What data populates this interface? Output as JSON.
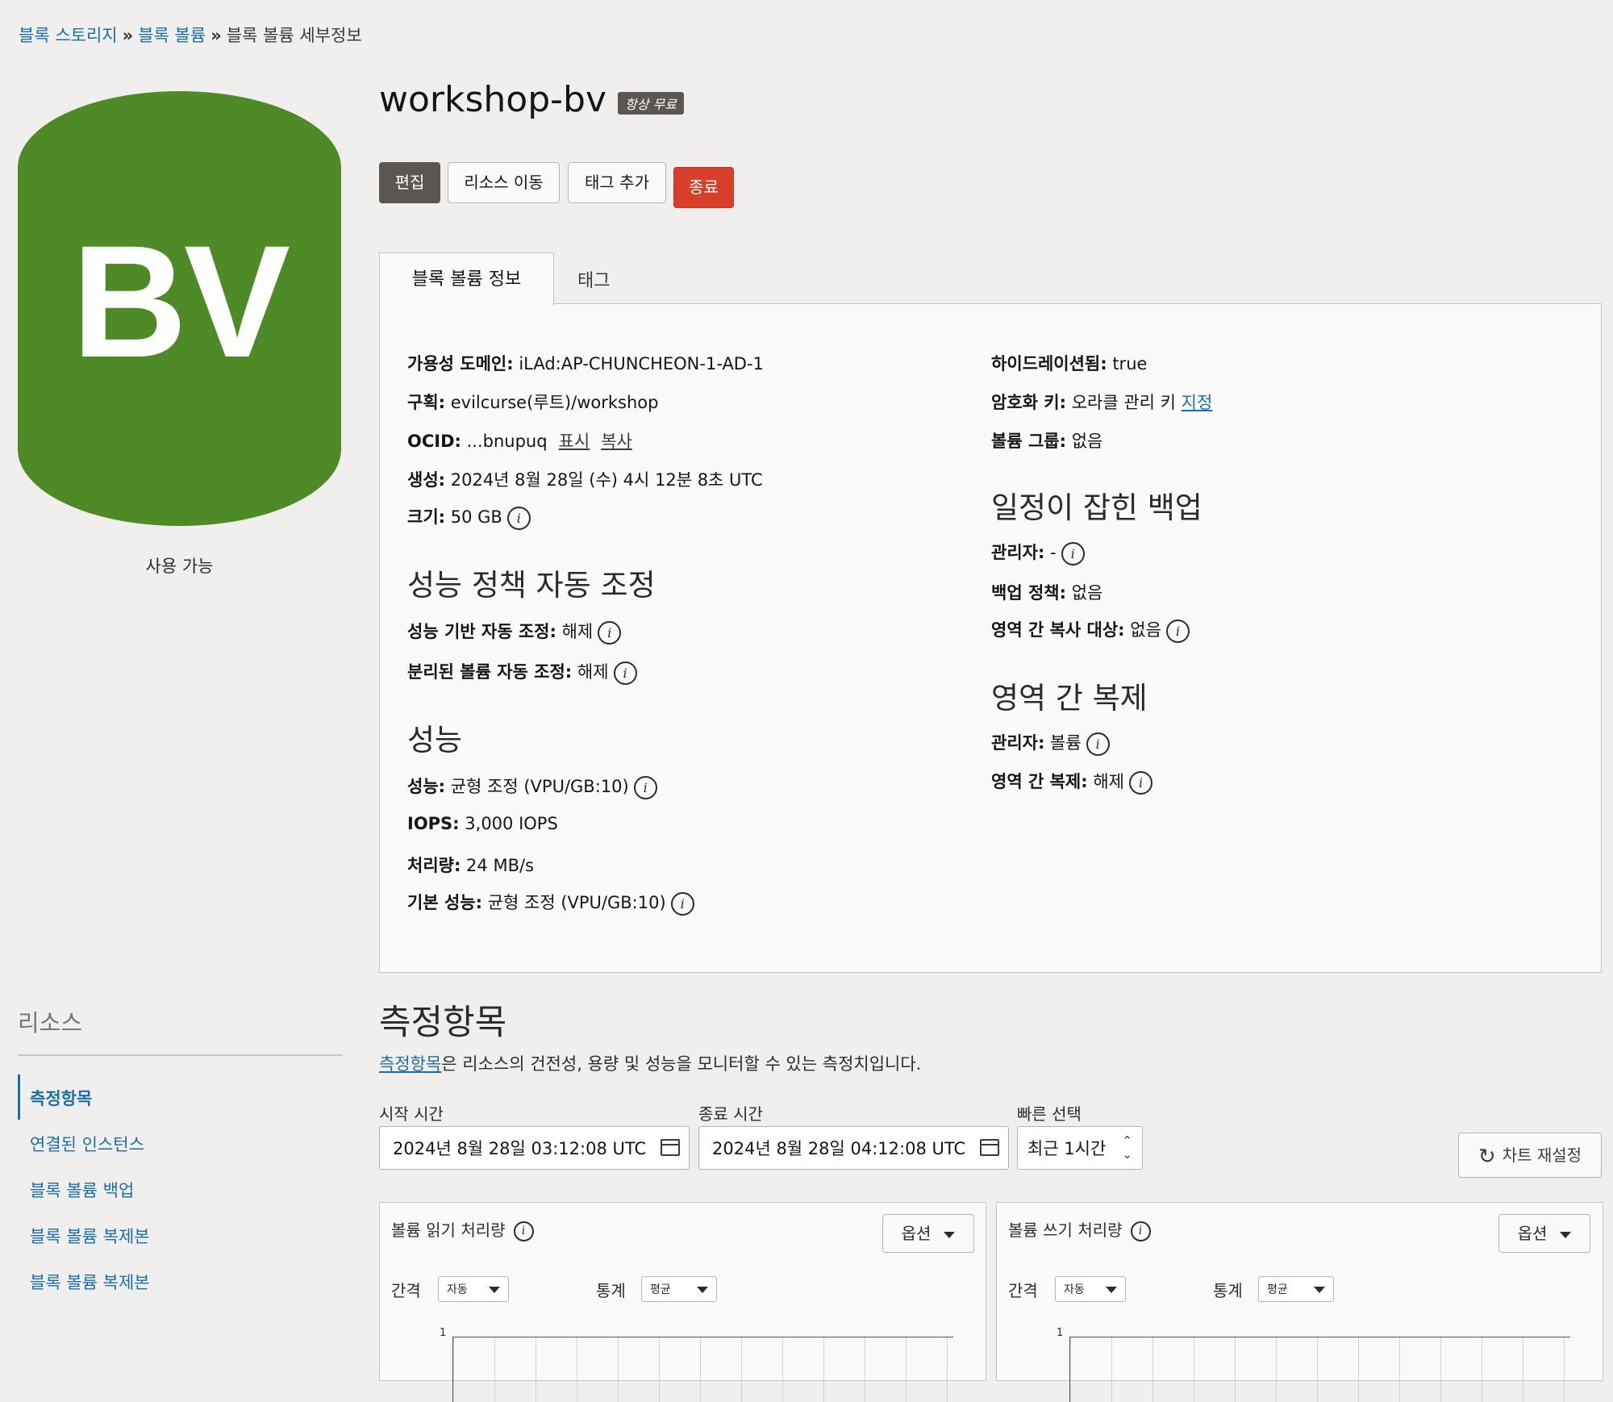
{
  "breadcrumb": {
    "items": [
      "블록 스토리지",
      "블록 볼륨",
      "블록 볼륨 세부정보"
    ],
    "separator": "»"
  },
  "resource_badge": {
    "abbr": "BV",
    "status": "사용 가능",
    "color": "#4e8a25"
  },
  "header": {
    "title": "workshop-bv",
    "tier_badge": "항상 무료",
    "buttons": {
      "edit": "편집",
      "move": "리소스 이동",
      "add_tag": "태그 추가",
      "terminate": "종료"
    }
  },
  "tabs": {
    "active": "블록 볼륨 정보",
    "inactive": "태그"
  },
  "details": {
    "availability_domain": {
      "label": "가용성 도메인:",
      "value": "iLAd:AP-CHUNCHEON-1-AD-1"
    },
    "compartment": {
      "label": "구획:",
      "value": "evilcurse(루트)/workshop"
    },
    "ocid": {
      "label": "OCID:",
      "value": "...bnupuq",
      "show": "표시",
      "copy": "복사"
    },
    "created": {
      "label": "생성:",
      "value": "2024년 8월 28일 (수) 4시 12분 8초 UTC"
    },
    "size": {
      "label": "크기:",
      "value": "50 GB"
    },
    "hydrated": {
      "label": "하이드레이션됨:",
      "value": "true"
    },
    "encryption": {
      "label": "암호화 키:",
      "value": "오라클 관리 키",
      "link": "지정"
    },
    "volume_group": {
      "label": "볼륨 그룹:",
      "value": "없음"
    }
  },
  "autotune": {
    "heading": "성능 정책 자동 조정",
    "perf_based": {
      "label": "성능 기반 자동 조정:",
      "value": "해제"
    },
    "detached": {
      "label": "분리된 볼륨 자동 조정:",
      "value": "해제"
    }
  },
  "performance": {
    "heading": "성능",
    "perf": {
      "label": "성능:",
      "value": "균형 조정 (VPU/GB:10)"
    },
    "iops": {
      "label": "IOPS:",
      "value": "3,000 IOPS"
    },
    "throughput": {
      "label": "처리량:",
      "value": "24 MB/s"
    },
    "base": {
      "label": "기본 성능:",
      "value": "균형 조정 (VPU/GB:10)"
    }
  },
  "scheduled_backups": {
    "heading": "일정이 잡힌 백업",
    "manager": {
      "label": "관리자:",
      "value": "-"
    },
    "policy": {
      "label": "백업 정책:",
      "value": "없음"
    },
    "cross_region": {
      "label": "영역 간 복사 대상:",
      "value": "없음"
    }
  },
  "cross_region_replication": {
    "heading": "영역 간 복제",
    "manager": {
      "label": "관리자:",
      "value": "볼륨"
    },
    "replication": {
      "label": "영역 간 복제:",
      "value": "해제"
    }
  },
  "sidebar": {
    "title": "리소스",
    "items": [
      {
        "label": "측정항목",
        "active": true
      },
      {
        "label": "연결된 인스턴스"
      },
      {
        "label": "블록 볼륨 백업"
      },
      {
        "label": "블록 볼륨 복제본"
      },
      {
        "label": "블록 볼륨 복제본"
      }
    ]
  },
  "metrics": {
    "title": "측정항목",
    "desc_link": "측정항목",
    "desc_rest": "은 리소스의 건전성, 용량 및 성능을 모니터할 수 있는 측정치입니다.",
    "start": {
      "label": "시작 시간",
      "value": "2024년 8월 28일 03:12:08 UTC"
    },
    "end": {
      "label": "종료 시간",
      "value": "2024년 8월 28일 04:12:08 UTC"
    },
    "quick": {
      "label": "빠른 선택",
      "value": "최근 1시간"
    },
    "reset": "차트 재설정",
    "cards": [
      {
        "title": "볼륨 읽기 처리량",
        "options": "옵션",
        "interval_label": "간격",
        "interval": "자동",
        "stat_label": "통계",
        "stat": "평균",
        "y_tick": "1"
      },
      {
        "title": "볼륨 쓰기 처리량",
        "options": "옵션",
        "interval_label": "간격",
        "interval": "자동",
        "stat_label": "통계",
        "stat": "평균",
        "y_tick": "1"
      }
    ]
  }
}
